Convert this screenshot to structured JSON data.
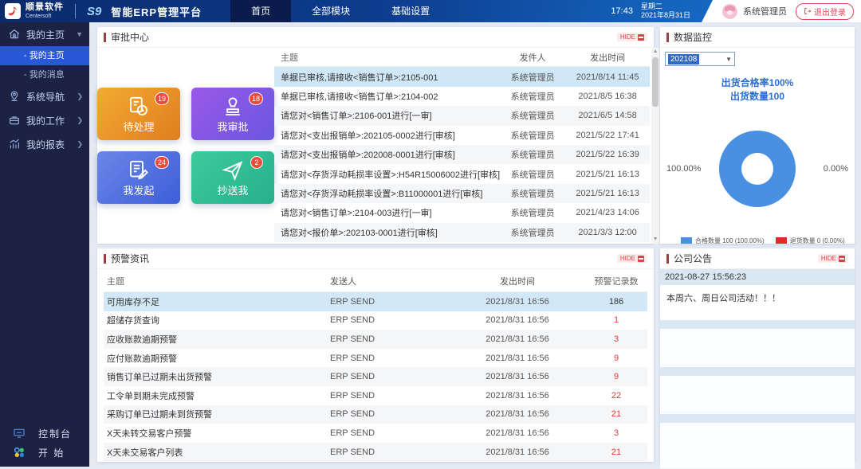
{
  "header": {
    "brand": "顺景软件",
    "brand_sub": "Centersoft",
    "product_logo": "S9",
    "product_name": "智能ERP管理平台",
    "nav": [
      {
        "label": "首页"
      },
      {
        "label": "全部模块"
      },
      {
        "label": "基础设置"
      }
    ],
    "time": "17:43",
    "weekday": "星期二",
    "date": "2021年8月31日",
    "user": "系统管理员",
    "logout_label": "退出登录"
  },
  "sidebar": {
    "groups": [
      {
        "label": "我的主页"
      },
      {
        "label": "系统导航"
      },
      {
        "label": "我的工作"
      },
      {
        "label": "我的报表"
      }
    ],
    "home_children": [
      {
        "label": "我的主页"
      },
      {
        "label": "我的消息"
      }
    ],
    "footer": [
      {
        "label": "控制台"
      },
      {
        "label": "开 始"
      }
    ]
  },
  "approval": {
    "title": "审批中心",
    "hide_label": "HIDE",
    "tiles": [
      {
        "label": "待处理",
        "badge": "19"
      },
      {
        "label": "我审批",
        "badge": "18"
      },
      {
        "label": "我发起",
        "badge": "24"
      },
      {
        "label": "抄送我",
        "badge": "2"
      }
    ],
    "columns": [
      "主题",
      "发件人",
      "发出时间"
    ],
    "rows": [
      {
        "subject": "单据已审核,请接收<销售订单>:2105-001",
        "sender": "系统管理员",
        "time": "2021/8/14 11:45"
      },
      {
        "subject": "单据已审核,请接收<销售订单>:2104-002",
        "sender": "系统管理员",
        "time": "2021/8/5 16:38"
      },
      {
        "subject": "请您对<销售订单>:2106-001进行[一审]",
        "sender": "系统管理员",
        "time": "2021/6/5 14:58"
      },
      {
        "subject": "请您对<支出报销单>:202105-0002进行[审核]",
        "sender": "系统管理员",
        "time": "2021/5/22 17:41"
      },
      {
        "subject": "请您对<支出报销单>:202008-0001进行[审核]",
        "sender": "系统管理员",
        "time": "2021/5/22 16:39"
      },
      {
        "subject": "请您对<存货浮动耗损率设置>:H54R15006002进行[审核]",
        "sender": "系统管理员",
        "time": "2021/5/21 16:13"
      },
      {
        "subject": "请您对<存货浮动耗损率设置>:B11000001进行[审核]",
        "sender": "系统管理员",
        "time": "2021/5/21 16:13"
      },
      {
        "subject": "请您对<销售订单>:2104-003进行[一审]",
        "sender": "系统管理员",
        "time": "2021/4/23 14:06"
      },
      {
        "subject": "请您对<报价单>:202103-0001进行[审核]",
        "sender": "系统管理员",
        "time": "2021/3/3 12:00"
      }
    ]
  },
  "monitor": {
    "title": "数据监控",
    "period": "202108",
    "line1": "出货合格率100%",
    "line2": "出货数量100",
    "left_label": "100.00%",
    "right_label": "0.00%",
    "legend": [
      {
        "label": "合格数量 100 (100.00%)",
        "color": "#4a90e2"
      },
      {
        "label": "退货数量 0 (0.00%)",
        "color": "#e02b2b"
      }
    ]
  },
  "chart_data": {
    "type": "pie",
    "donut": true,
    "title": "出货合格率100% 出货数量100",
    "labels": [
      "合格数量",
      "退货数量"
    ],
    "values": [
      100,
      0
    ],
    "percents": [
      "100.00%",
      "0.00%"
    ],
    "colors": [
      "#4a90e2",
      "#e02b2b"
    ],
    "legend_position": "bottom"
  },
  "alerts": {
    "title": "预警资讯",
    "hide_label": "HIDE",
    "columns": [
      "主题",
      "发送人",
      "发出时间",
      "预警记录数"
    ],
    "rows": [
      {
        "subject": "可用库存不足",
        "sender": "ERP SEND",
        "time": "2021/8/31 16:56",
        "count": "186"
      },
      {
        "subject": "超储存货查询",
        "sender": "ERP SEND",
        "time": "2021/8/31 16:56",
        "count": "1"
      },
      {
        "subject": "应收账款逾期预警",
        "sender": "ERP SEND",
        "time": "2021/8/31 16:56",
        "count": "3"
      },
      {
        "subject": "应付账款逾期预警",
        "sender": "ERP SEND",
        "time": "2021/8/31 16:56",
        "count": "9"
      },
      {
        "subject": "销售订单已过期未出货预警",
        "sender": "ERP SEND",
        "time": "2021/8/31 16:56",
        "count": "9"
      },
      {
        "subject": "工令单到期未完成预警",
        "sender": "ERP SEND",
        "time": "2021/8/31 16:56",
        "count": "22"
      },
      {
        "subject": "采购订单已过期未到货预警",
        "sender": "ERP SEND",
        "time": "2021/8/31 16:56",
        "count": "21"
      },
      {
        "subject": "X天未转交易客户预警",
        "sender": "ERP SEND",
        "time": "2021/8/31 16:56",
        "count": "3"
      },
      {
        "subject": "X天未交易客户列表",
        "sender": "ERP SEND",
        "time": "2021/8/31 16:56",
        "count": "21"
      }
    ]
  },
  "announcements": {
    "title": "公司公告",
    "hide_label": "HIDE",
    "items": [
      {
        "time": "2021-08-27 15:56:23",
        "content": "本周六、周日公司活动！！！"
      }
    ]
  }
}
